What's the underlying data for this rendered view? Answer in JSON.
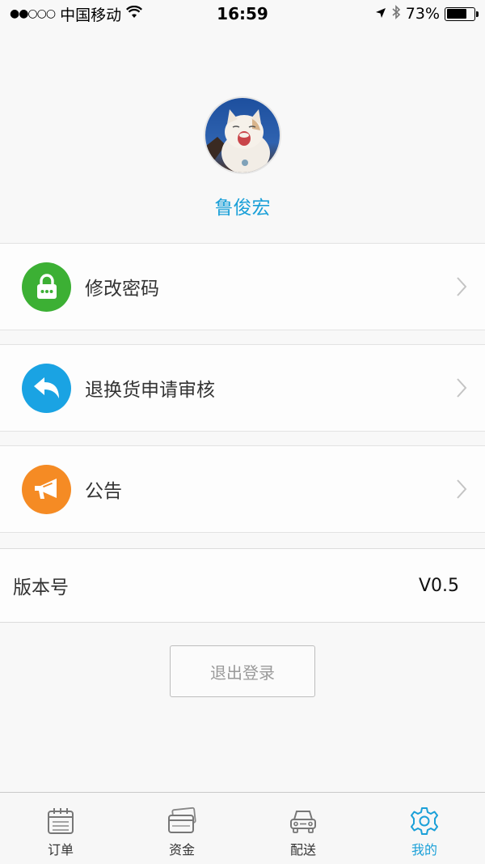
{
  "status_bar": {
    "signal": "●●○○○",
    "carrier": "中国移动",
    "time": "16:59",
    "battery_text": "73%",
    "battery_level": 0.73
  },
  "profile": {
    "user_name": "鲁俊宏"
  },
  "menu": {
    "items": [
      {
        "label": "修改密码",
        "icon": "lock-icon",
        "color": "#3cb034"
      },
      {
        "label": "退换货申请审核",
        "icon": "reply-arrow-icon",
        "color": "#1aa3e3"
      },
      {
        "label": "公告",
        "icon": "megaphone-icon",
        "color": "#f58b24"
      }
    ]
  },
  "version": {
    "label": "版本号",
    "value": "V0.5"
  },
  "logout": {
    "label": "退出登录"
  },
  "tab_bar": {
    "accent": "#1ba0d8",
    "tabs": [
      {
        "label": "订单",
        "icon": "calendar-icon"
      },
      {
        "label": "资金",
        "icon": "card-icon"
      },
      {
        "label": "配送",
        "icon": "car-icon"
      },
      {
        "label": "我的",
        "icon": "gear-icon",
        "active": true
      }
    ]
  }
}
